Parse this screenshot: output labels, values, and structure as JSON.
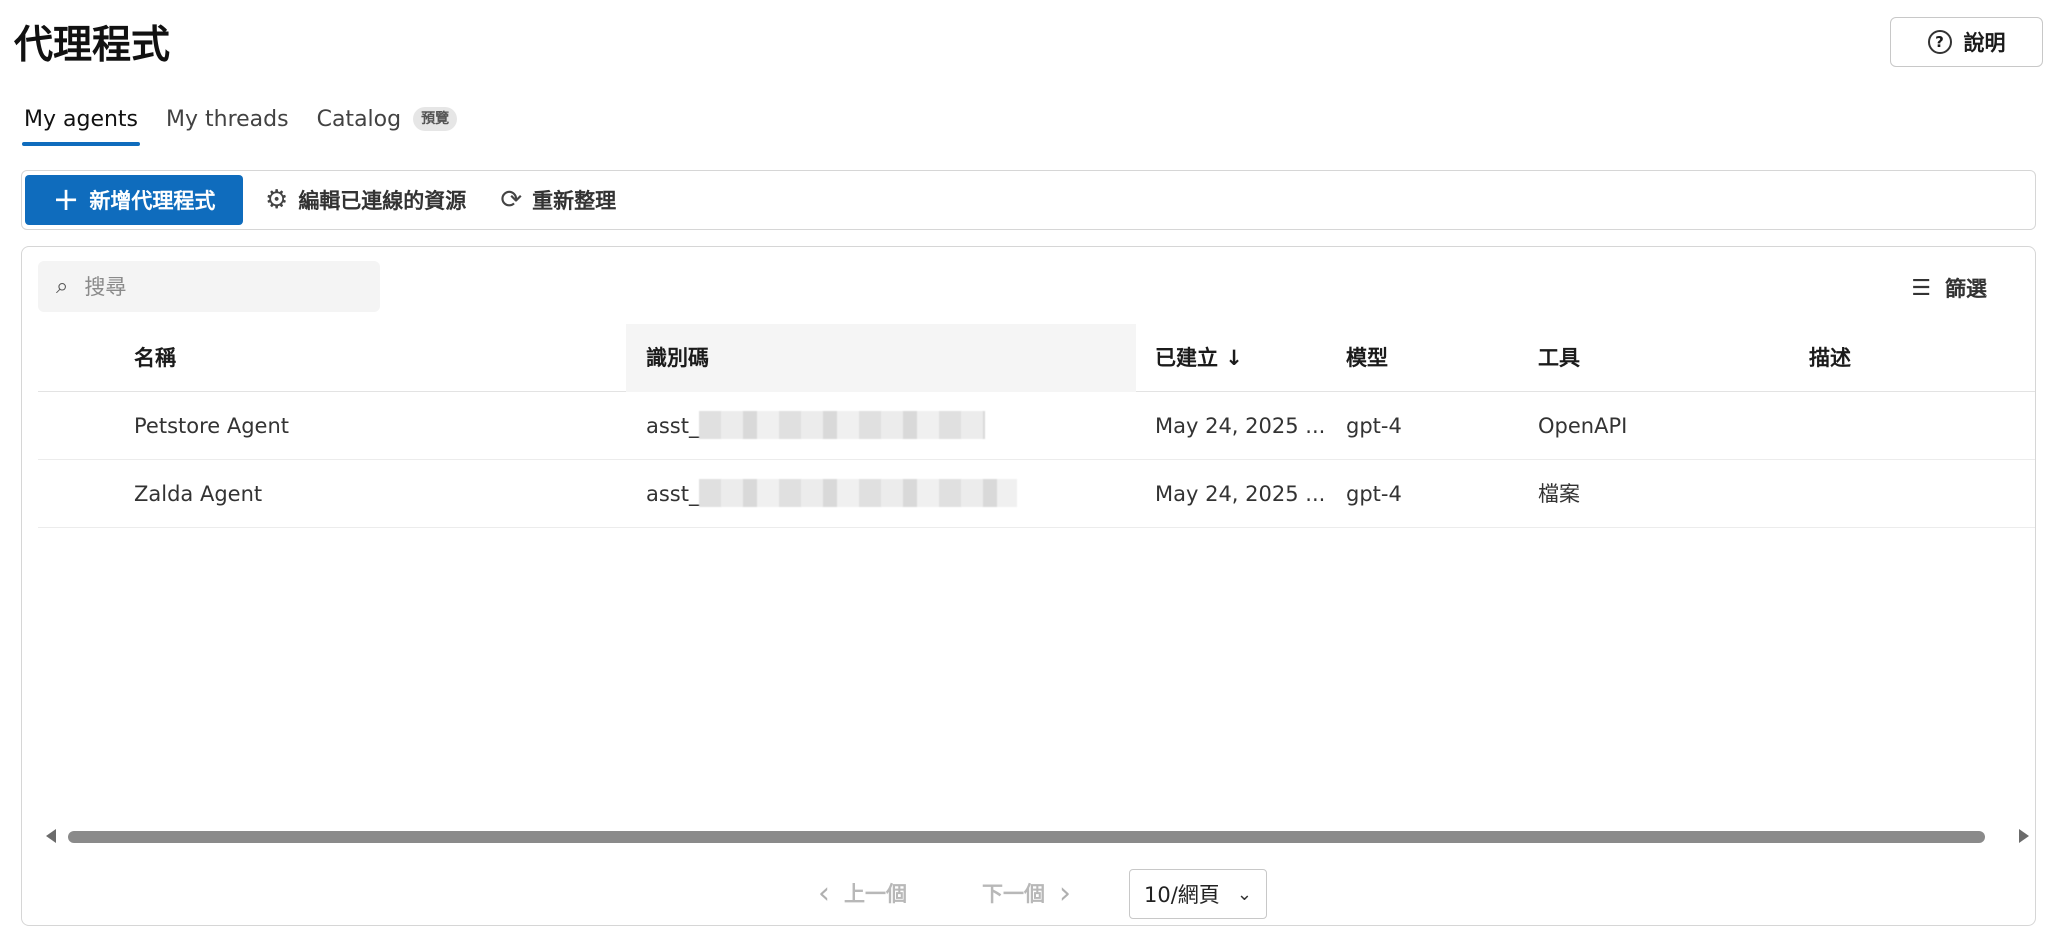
{
  "header": {
    "title": "代理程式",
    "help_label": "說明"
  },
  "tabs": [
    {
      "label": "My agents"
    },
    {
      "label": "My threads"
    },
    {
      "label": "Catalog",
      "badge": "預覽"
    }
  ],
  "toolbar": {
    "new_agent_label": "新增代理程式",
    "edit_resources_label": "編輯已連線的資源",
    "refresh_label": "重新整理"
  },
  "search": {
    "placeholder": "搜尋"
  },
  "filter": {
    "label": "篩選"
  },
  "table": {
    "columns": [
      "名稱",
      "識別碼",
      "已建立 ↓",
      "模型",
      "工具",
      "描述"
    ],
    "rows": [
      {
        "name": "Petstore Agent",
        "id_prefix": "asst_",
        "created": "May 24, 2025 ...",
        "model": "gpt-4",
        "tools": "OpenAPI",
        "description": ""
      },
      {
        "name": "Zalda Agent",
        "id_prefix": "asst_",
        "created": "May 24, 2025 ...",
        "model": "gpt-4",
        "tools": "檔案",
        "description": ""
      }
    ]
  },
  "pagination": {
    "prev_label": "上一個",
    "next_label": "下一個",
    "per_page": "10/網頁"
  },
  "colors": {
    "accent": "#0f6cbd"
  },
  "icons": [
    "help-icon",
    "plus-icon",
    "gear-icon",
    "refresh-icon",
    "search-icon",
    "filter-icon",
    "chevron-left-icon",
    "chevron-right-icon",
    "chevron-down-icon"
  ]
}
